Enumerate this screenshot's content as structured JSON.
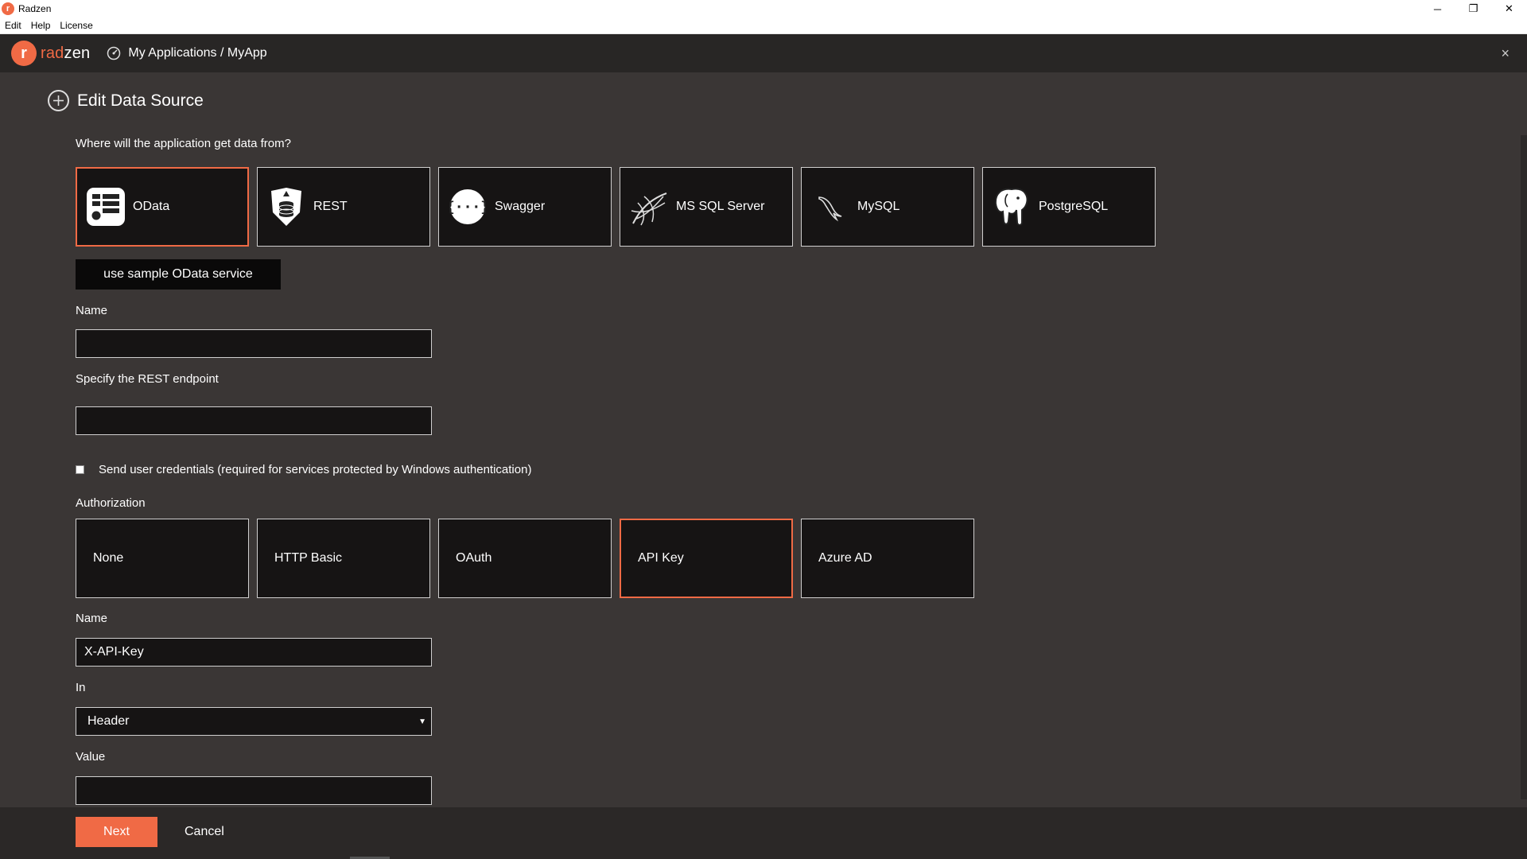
{
  "os": {
    "app_icon": "radzen-logo-icon",
    "title": "Radzen",
    "minimize": "─",
    "restore": "❐",
    "close": "✕"
  },
  "menu": [
    "Edit",
    "Help",
    "License"
  ],
  "header": {
    "logo_mark": "r",
    "logo_text_a": "rad",
    "logo_text_b": "zen",
    "breadcrumb_icon": "dashboard-icon",
    "breadcrumb": "My Applications / MyApp",
    "close": "×"
  },
  "page": {
    "title_icon": "add-circle-icon",
    "title": "Edit Data Source"
  },
  "source": {
    "question": "Where will the application get data from?",
    "tiles": [
      {
        "label": "OData",
        "icon": "odata-icon",
        "selected": true
      },
      {
        "label": "REST",
        "icon": "rest-shield-icon",
        "selected": false
      },
      {
        "label": "Swagger",
        "icon": "swagger-icon",
        "selected": false
      },
      {
        "label": "MS SQL Server",
        "icon": "ms-sql-server-icon",
        "selected": false
      },
      {
        "label": "MySQL",
        "icon": "mysql-dolphin-icon",
        "selected": false
      },
      {
        "label": "PostgreSQL",
        "icon": "postgresql-elephant-icon",
        "selected": false
      }
    ],
    "sample_button": "use sample OData service"
  },
  "form": {
    "name_label": "Name",
    "name_value": "",
    "endpoint_label": "Specify the REST endpoint",
    "endpoint_value": "",
    "credentials_label": "Send user credentials (required for services protected by Windows authentication)",
    "credentials_checked": false
  },
  "authorization": {
    "label": "Authorization",
    "tiles": [
      {
        "label": "None",
        "selected": false
      },
      {
        "label": "HTTP Basic",
        "selected": false
      },
      {
        "label": "OAuth",
        "selected": false
      },
      {
        "label": "API Key",
        "selected": true
      },
      {
        "label": "Azure AD",
        "selected": false
      }
    ]
  },
  "apikey": {
    "name_label": "Name",
    "name_value": "X-API-Key",
    "in_label": "In",
    "in_value": "Header",
    "value_label": "Value",
    "value_value": ""
  },
  "footer": {
    "next": "Next",
    "cancel": "Cancel"
  },
  "colors": {
    "accent": "#f06a45",
    "background": "#3a3635",
    "tile_bg": "#161414"
  }
}
